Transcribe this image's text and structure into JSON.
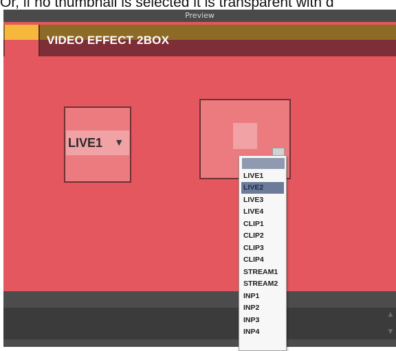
{
  "document": {
    "visible_text": "Or, if no thumbnail is selected it is transparent with d"
  },
  "window": {
    "title": "Preview"
  },
  "banner": {
    "title": "VIDEO EFFECT 2BOX"
  },
  "box1": {
    "selected_source": "LIVE1"
  },
  "box2": {
    "selected_source": ""
  },
  "dropdown": {
    "items": [
      "",
      "LIVE1",
      "LIVE2",
      "LIVE3",
      "LIVE4",
      "CLIP1",
      "CLIP2",
      "CLIP3",
      "CLIP4",
      "STREAM1",
      "STREAM2",
      "INP1",
      "INP2",
      "INP3",
      "INP4"
    ],
    "highlighted": "LIVE2"
  },
  "icons": {
    "dropdown_arrow": "triangle-down-icon",
    "scroll_up": "scroll-up-icon",
    "scroll_down": "scroll-down-icon"
  },
  "colors": {
    "stage": "#e5575e",
    "banner_gold": "#8e6a27",
    "banner_maroon": "#7e2e36",
    "banner_yellow": "#f5b83c",
    "highlight": "#6b7b99"
  }
}
